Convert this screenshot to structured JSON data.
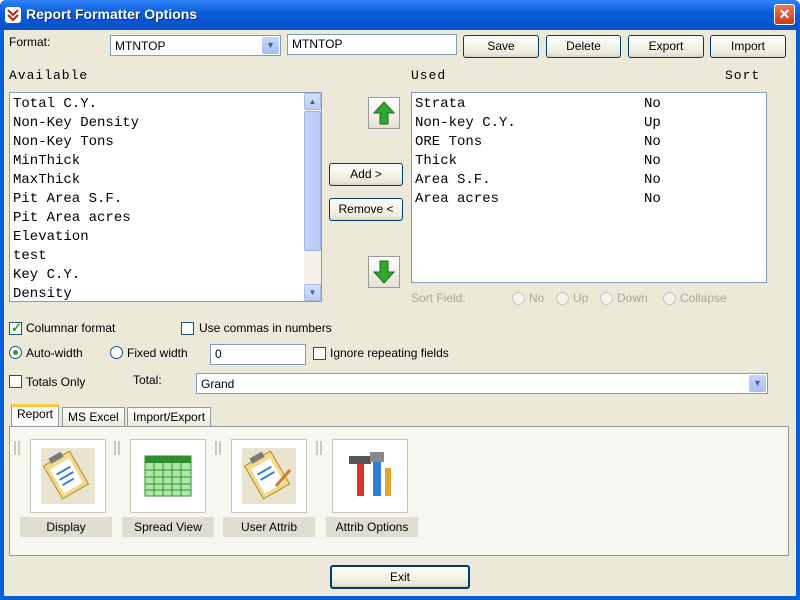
{
  "window": {
    "title": "Report Formatter Options",
    "close_glyph": "✕"
  },
  "format": {
    "label": "Format:",
    "selected": "MTNTOP",
    "name_value": "MTNTOP",
    "buttons": {
      "save": "Save",
      "delete": "Delete",
      "export": "Export",
      "import": "Import"
    }
  },
  "available": {
    "header": "Available",
    "items": [
      "Total C.Y.",
      "Non-Key Density",
      "Non-Key Tons",
      "MinThick",
      "MaxThick",
      "Pit Area S.F.",
      "Pit Area acres",
      "Elevation",
      "test",
      "Key C.Y.",
      "Density"
    ]
  },
  "used": {
    "header": "Used",
    "sort_header": "Sort",
    "rows": [
      {
        "field": "Strata",
        "sort": "No"
      },
      {
        "field": "Non-key C.Y.",
        "sort": "Up"
      },
      {
        "field": "ORE Tons",
        "sort": "No"
      },
      {
        "field": "Thick",
        "sort": "No"
      },
      {
        "field": "Area S.F.",
        "sort": "No"
      },
      {
        "field": "Area acres",
        "sort": "No"
      }
    ]
  },
  "transfer": {
    "add": "Add >",
    "remove": "Remove <"
  },
  "sort_field": {
    "label": "Sort Field:",
    "options": [
      "No",
      "Up",
      "Down",
      "Collapse"
    ]
  },
  "options": {
    "columnar_format": "Columnar format",
    "use_commas": "Use commas in numbers",
    "auto_width": "Auto-width",
    "fixed_width": "Fixed width",
    "fixed_width_value": "0",
    "ignore_repeating": "Ignore repeating fields",
    "totals_only": "Totals Only",
    "total_label": "Total:",
    "total_value": "Grand"
  },
  "tabs": [
    "Report",
    "MS Excel",
    "Import/Export"
  ],
  "tools": [
    {
      "label": "Display",
      "icon": "clipboard-icon"
    },
    {
      "label": "Spread View",
      "icon": "spreadsheet-icon"
    },
    {
      "label": "User Attrib",
      "icon": "clipboard-edit-icon"
    },
    {
      "label": "Attrib Options",
      "icon": "tools-icon"
    }
  ],
  "exit_label": "Exit",
  "colors": {
    "title_bar": "#0a5fd8",
    "dialog_bg": "#ece9d8",
    "arrow_green": "#2ea82e"
  }
}
